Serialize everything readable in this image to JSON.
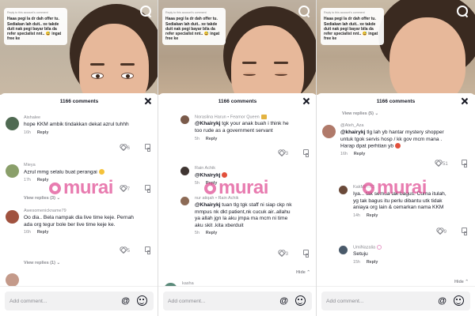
{
  "panels": [
    {
      "bubble": {
        "header": "Reply to this account's comment",
        "text": "Haaa pegi la dr dah offer tu. Sediakan lah duit.. xe takde duit nak pegi bayar bila da refer specialist nnt.. 😅 ingat free ke"
      },
      "sheet": {
        "title": "1166 comments"
      },
      "comments": [
        {
          "user": "Aishalee",
          "text": "hope KKM ambik tindakkan dekat azrul tuhhh",
          "time": "16h",
          "reply": "Reply",
          "likes": "6"
        },
        {
          "user": "Mieya",
          "text": "Azrul mmg selalu buat perangai",
          "time": "17h",
          "reply": "Reply",
          "likes": "7"
        },
        {
          "user": "Awesomenickname79",
          "text": "Oo dia.. Bela nampak dia live time keje. Pernah ada org tegur bole ber live time keje ke.",
          "time": "16h",
          "reply": "Reply",
          "likes": "5"
        }
      ],
      "view_replies_1": "View replies (3)",
      "view_replies_2": "View replies (1)",
      "input": {
        "placeholder": "Add comment..."
      }
    },
    {
      "bubble": {
        "header": "Reply to this account's comment",
        "text": "Haaa pegi la dr dah offer tu. Sediakan lah duit.. xe takde duit nak pegi bayar bila da refer specialist nnt.. 😅 ingat free ke"
      },
      "sheet": {
        "title": "1166 comments"
      },
      "comments": [
        {
          "user": "Noraslina Harun • Feamor Queen",
          "text_mention": "@Khairykj",
          "text": "tgk your anak buah i think he too rude as a government servant",
          "time": "5h",
          "reply": "Reply",
          "likes": "3"
        },
        {
          "user": "Rain Achik",
          "text_mention": "@Khairykj",
          "text": "",
          "time": "5h",
          "reply": "Reply",
          "likes": ""
        },
        {
          "user": "nur atiqah • Rain Achik",
          "text_mention": "@Khairykj",
          "text": "tuan tlg tgk staff ni siap ckp nk mmpus nk dkt patient,nk cucuk air..allahu ya allah jgn la aku jmpa ma mcm ni time aku skit .kita xberduit",
          "time": "5h",
          "reply": "Reply",
          "likes": "3"
        }
      ],
      "hide": "Hide",
      "last_user": "kasha",
      "input": {
        "placeholder": "Add comment..."
      }
    },
    {
      "bubble": {
        "header": "Reply to this account's comment",
        "text": "Haaa pegi la dr dah offer tu. Sediakan lah duit.. xe takde duit nak pegi bayar bila da refer specialist nnt.. 😅 ingat free ke"
      },
      "sheet": {
        "title": "1166 comments"
      },
      "view_replies_top": "View replies (5)",
      "comments": [
        {
          "user": "@Ateh_Aza",
          "text_mention": "@khairykj",
          "text": "tlg lah yb hantar mystery shopper untuk tgok servis hosp / kk gov mcm mana . Harap dpat perhtian yb",
          "time": "16h",
          "reply": "Reply",
          "likes": "51"
        },
        {
          "user": "KakMilla23",
          "text": "Iya... tak semua tak bagus. Cuma itulah, yg tak bagus itu perlu dibantu utk tidak aniaya org lain & cemarkan nama KKM",
          "time": "14h",
          "reply": "Reply",
          "likes": "9"
        },
        {
          "user": "UmiNazalia",
          "text": "Setuju",
          "time": "15h",
          "reply": "Reply",
          "likes": ""
        }
      ],
      "hide": "Hide",
      "input": {
        "placeholder": "Add comment..."
      }
    }
  ],
  "watermark": {
    "text": "murai"
  },
  "colors": {
    "accent": "#e04b92",
    "text": "#161823",
    "muted": "#8a8b91"
  }
}
